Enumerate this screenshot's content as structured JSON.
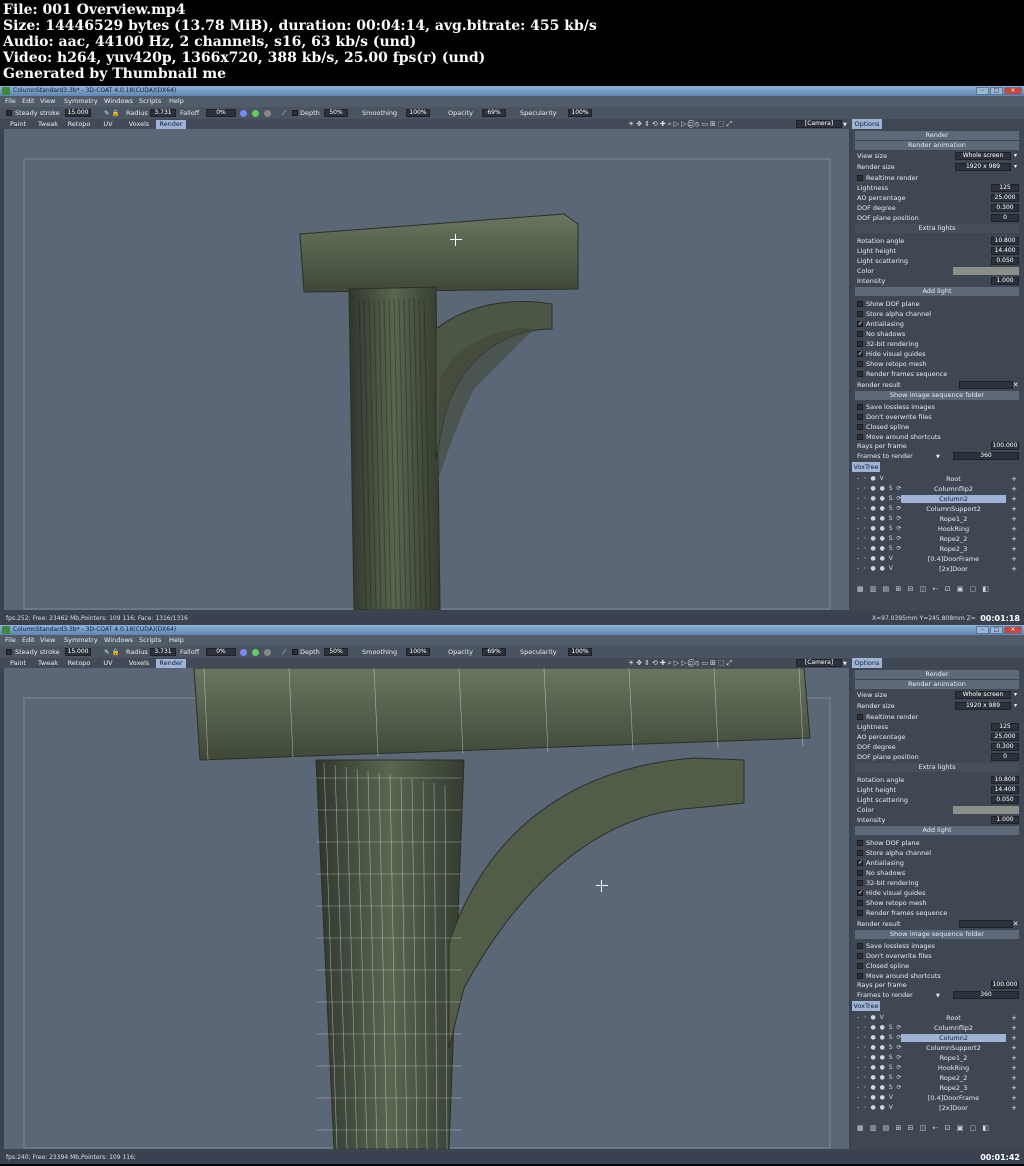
{
  "header": {
    "lines": [
      "File: 001 Overview.mp4",
      "Size: 14446529 bytes (13.78 MiB), duration: 00:04:14, avg.bitrate: 455 kb/s",
      "Audio: aac, 44100 Hz, 2 channels, s16, 63 kb/s (und)",
      "Video: h264, yuv420p, 1366x720, 388 kb/s, 25.00 fps(r) (und)",
      "Generated by Thumbnail me"
    ]
  },
  "colors": {
    "accent": "#9fb4d4",
    "panel": "#3f4753",
    "viewport": "#5b6676"
  },
  "frames": [
    {
      "title": "ColumnStandard3.3b* - 3D-COAT 4.0.18(CUDA)(DX64)",
      "menu": [
        "File",
        "Edit",
        "View",
        "Symmetry",
        "Windows",
        "Scripts",
        "Help"
      ],
      "toolbar": {
        "steady_label": "Steady stroke",
        "steady_value": "15.000",
        "radius_label": "Radius",
        "radius_value": "3.731",
        "falloff_label": "Falloff",
        "falloff_value": "0%",
        "depth_label": "Depth",
        "depth_value": "50%",
        "smoothing_label": "Smoothing",
        "smoothing_value": "100%",
        "opacity_label": "Opacity",
        "opacity_value": "69%",
        "specularity_label": "Specularity",
        "specularity_value": "100%"
      },
      "tabs": [
        "Paint",
        "Tweak",
        "Retopo",
        "UV",
        "Voxels",
        "Render"
      ],
      "active_tab": "Render",
      "camera": "[Camera]",
      "status": "fps:252;   Free: 23462 Mb,Pointers: 109  116;  Face: 1316/1316",
      "coords": "X=97.0395mm  Y=245.808mm  Z=",
      "timecode": "00:01:18"
    },
    {
      "title": "ColumnStandard3.3b* - 3D-COAT 4.0.18(CUDA)(DX64)",
      "menu": [
        "File",
        "Edit",
        "View",
        "Symmetry",
        "Windows",
        "Scripts",
        "Help"
      ],
      "toolbar": {
        "steady_label": "Steady stroke",
        "steady_value": "15.000",
        "radius_label": "Radius",
        "radius_value": "3.731",
        "falloff_label": "Falloff",
        "falloff_value": "0%",
        "depth_label": "Depth",
        "depth_value": "50%",
        "smoothing_label": "Smoothing",
        "smoothing_value": "100%",
        "opacity_label": "Opacity",
        "opacity_value": "69%",
        "specularity_label": "Specularity",
        "specularity_value": "100%"
      },
      "tabs": [
        "Paint",
        "Tweak",
        "Retopo",
        "UV",
        "Voxels",
        "Render"
      ],
      "active_tab": "Render",
      "camera": "[Camera]",
      "status": "fps:240;   Free: 23394 Mb,Pointers: 109  116;",
      "coords": "",
      "timecode": "00:01:42"
    }
  ],
  "options": {
    "tab": "Options",
    "render_btn": "Render",
    "render_anim_btn": "Render animation",
    "view_size_label": "View size",
    "view_size_value": "Whole screen",
    "render_size_label": "Render size",
    "render_size_value": "1920  x  989",
    "realtime_label": "Realtime render",
    "lightness_label": "Lightness",
    "lightness_value": "125",
    "ao_label": "AO percentage",
    "ao_value": "25.000",
    "dof_label": "DOF degree",
    "dof_value": "0.300",
    "dofpos_label": "DOF plane position",
    "dofpos_value": "0",
    "extra_lights": "Extra lights",
    "rotation_label": "Rotation angle",
    "rotation_value": "10.800",
    "height_label": "Light height",
    "height_value": "14.400",
    "scatter_label": "Light scattering",
    "scatter_value": "0.050",
    "color_label": "Color",
    "intensity_label": "Intensity",
    "intensity_value": "1.000",
    "add_light": "Add light",
    "checks": [
      {
        "label": "Show DOF plane",
        "checked": false
      },
      {
        "label": "Store alpha channel",
        "checked": false
      },
      {
        "label": "Antialiasing",
        "checked": true
      },
      {
        "label": "No shadows",
        "checked": false
      },
      {
        "label": "32-bit rendering",
        "checked": false
      },
      {
        "label": "Hide visual guides",
        "checked": true
      },
      {
        "label": "Show retopo mesh",
        "checked": false
      },
      {
        "label": "Render frames sequence",
        "checked": false
      }
    ],
    "render_result_label": "Render result",
    "show_seq_folder": "Show image sequence folder",
    "checks2": [
      {
        "label": "Save lossless images",
        "checked": false
      },
      {
        "label": "Don't overwrite files",
        "checked": false
      },
      {
        "label": "Closed spline",
        "checked": false
      },
      {
        "label": "Move around shortcuts",
        "checked": false
      }
    ],
    "rays_label": "Rays per frame",
    "rays_value": "100.000",
    "frames_label": "Frames to render",
    "frames_value": "360"
  },
  "voxtree": {
    "tab": "VoxTree",
    "items": [
      {
        "icons": "- ◦ ● V",
        "name": "Root",
        "selected": false
      },
      {
        "icons": "- ◦ ● ● S ⟳",
        "name": "Columnflip2",
        "selected": false
      },
      {
        "icons": "- ◦ ● ● S ⟳",
        "name": "Column2",
        "selected": true
      },
      {
        "icons": "- ◦ ● ● S ⟳",
        "name": "ColumnSupport2",
        "selected": false
      },
      {
        "icons": "- ◦ ● ● S ⟳",
        "name": "Rope1_2",
        "selected": false
      },
      {
        "icons": "- ◦ ● ● S ⟳",
        "name": "HookRing",
        "selected": false
      },
      {
        "icons": "- ◦ ● ● S ⟳",
        "name": "Rope2_2",
        "selected": false
      },
      {
        "icons": "- ◦ ● ● S ⟳",
        "name": "Rope2_3",
        "selected": false
      },
      {
        "icons": "- ◦ ● ● V",
        "name": "[0.4]DoorFrame",
        "selected": false
      },
      {
        "icons": "- ◦ ● ● V",
        "name": "[2x]Door",
        "selected": false
      }
    ],
    "tools": "▦ ▥ ▤ ⊞ ⊟ ◫ ⇠ ⊡ ▣ ▢ ◧"
  }
}
